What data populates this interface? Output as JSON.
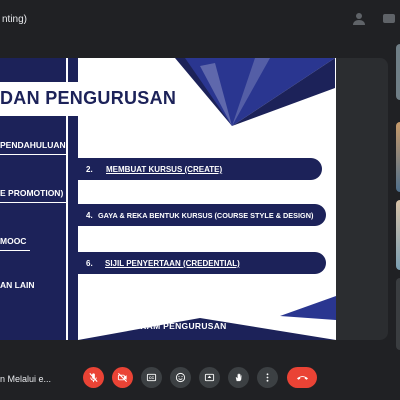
{
  "meeting": {
    "title": "nting)"
  },
  "slide": {
    "title": "DAN PENGURUSAN",
    "left_items": [
      {
        "label": "PENDAHULUAN"
      },
      {
        "label": "E PROMOTION)"
      },
      {
        "label": "MOOC"
      },
      {
        "label": "AN LAIN"
      }
    ],
    "pills": [
      {
        "number": "2.",
        "label": "MEMBUAT KURSUS (CREATE)"
      },
      {
        "number": "4.",
        "label": "GAYA & REKA BENTUK KURSUS (COURSE STYLE & DESIGN)"
      },
      {
        "number": "6.",
        "label": "SIJIL PENYERTAAN (CREDENTIAL)"
      }
    ],
    "footer": "PROGRAM PENGURUSAN"
  },
  "presenter": {
    "name": "n Melalui e..."
  },
  "controls": [
    {
      "icon": "mic-off-icon",
      "state": "off"
    },
    {
      "icon": "camera-off-icon",
      "state": "off"
    },
    {
      "icon": "captions-icon"
    },
    {
      "icon": "emoji-icon"
    },
    {
      "icon": "present-icon"
    },
    {
      "icon": "raise-hand-icon"
    },
    {
      "icon": "more-options-icon"
    },
    {
      "icon": "end-call-icon"
    }
  ],
  "colors": {
    "background": "#202124",
    "slide_navy": "#1c2259",
    "danger": "#ea4335",
    "control": "#3c4043"
  }
}
